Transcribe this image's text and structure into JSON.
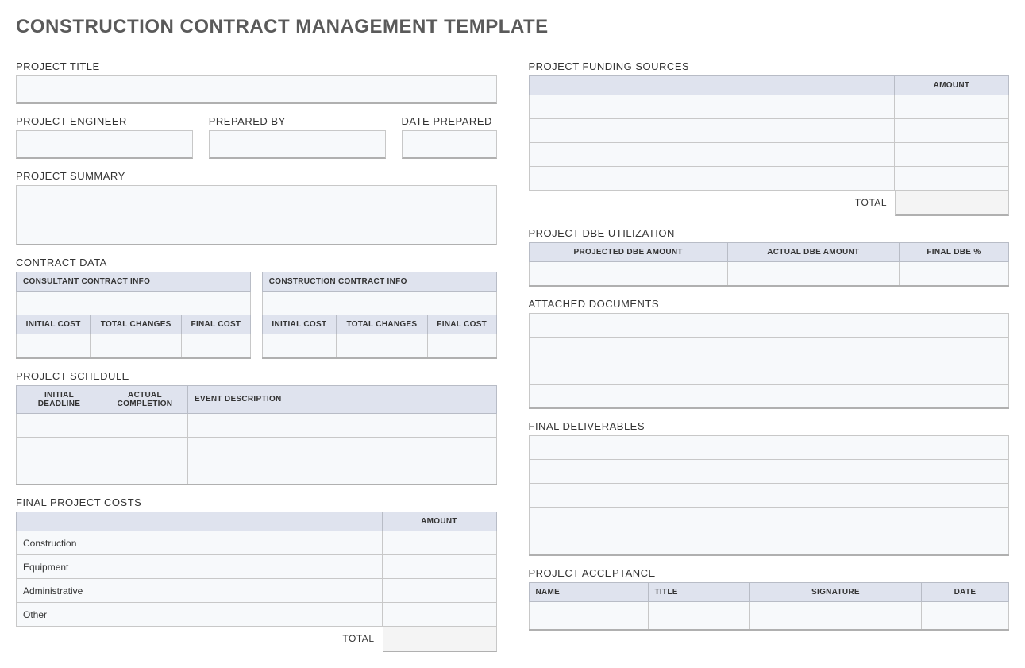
{
  "title": "CONSTRUCTION CONTRACT MANAGEMENT TEMPLATE",
  "left": {
    "project_title_label": "PROJECT TITLE",
    "project_engineer_label": "PROJECT ENGINEER",
    "prepared_by_label": "PREPARED BY",
    "date_prepared_label": "DATE PREPARED",
    "project_summary_label": "PROJECT SUMMARY",
    "contract_data_label": "CONTRACT DATA",
    "consultant_info": "CONSULTANT CONTRACT INFO",
    "construction_info": "CONSTRUCTION CONTRACT INFO",
    "initial_cost": "INITIAL COST",
    "total_changes": "TOTAL CHANGES",
    "final_cost": "FINAL COST",
    "project_schedule_label": "PROJECT SCHEDULE",
    "initial_deadline": "INITIAL DEADLINE",
    "actual_completion": "ACTUAL COMPLETION",
    "event_description": "EVENT DESCRIPTION",
    "final_costs_label": "FINAL PROJECT COSTS",
    "amount": "AMOUNT",
    "cost_rows": [
      "Construction",
      "Equipment",
      "Administrative",
      "Other"
    ],
    "total": "TOTAL"
  },
  "right": {
    "funding_label": "PROJECT FUNDING SOURCES",
    "amount": "AMOUNT",
    "total": "TOTAL",
    "dbe_label": "PROJECT DBE UTILIZATION",
    "projected_dbe": "PROJECTED DBE AMOUNT",
    "actual_dbe": "ACTUAL DBE AMOUNT",
    "final_dbe": "FINAL DBE %",
    "attached_label": "ATTACHED DOCUMENTS",
    "deliverables_label": "FINAL DELIVERABLES",
    "acceptance_label": "PROJECT ACCEPTANCE",
    "name": "NAME",
    "title": "TITLE",
    "signature": "SIGNATURE",
    "date": "DATE"
  }
}
